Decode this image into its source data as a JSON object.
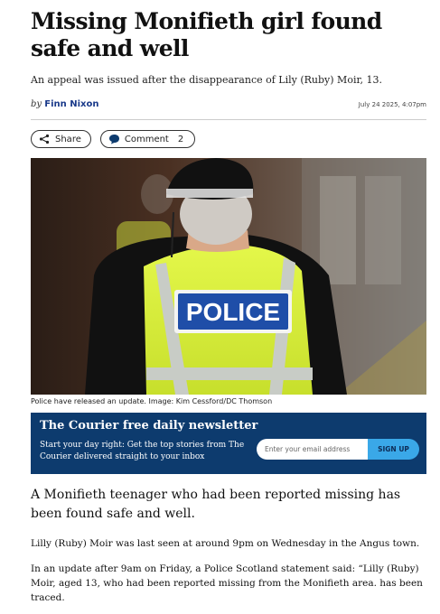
{
  "article": {
    "headline": "Missing Monifieth girl found safe and well",
    "standfirst": "An appeal was issued after the disappearance of Lily (Ruby) Moir, 13.",
    "byline_prefix": "by",
    "author": "Finn Nixon",
    "timestamp": "July 24 2025, 4:07pm"
  },
  "actions": {
    "share_label": "Share",
    "comment_label": "Comment",
    "comment_count": "2"
  },
  "image": {
    "badge_text": "POLICE",
    "caption": "Police have released an update. Image: Kim Cessford/DC Thomson"
  },
  "newsletter": {
    "title": "The Courier free daily newsletter",
    "text": "Start your day right: Get the top stories from The Courier delivered straight to your inbox",
    "email_placeholder": "Enter your email address",
    "button_label": "SIGN UP"
  },
  "body": {
    "lead": "A Monifieth teenager who had been reported missing has been found safe and well.",
    "p1": "Lilly (Ruby) Moir was last seen at around 9pm on Wednesday in the Angus town.",
    "p2": "In an update after 9am on Friday, a Police Scotland statement said: “Lilly (Ruby) Moir, aged 13, who had been reported missing from the Monifieth area. has been traced."
  },
  "colors": {
    "newsletter_bg": "#0d3b6e",
    "signup_button": "#3aa8e8",
    "author_link": "#1a3a8a",
    "hi_vis_yellow": "#d9f23a",
    "police_badge_blue": "#1f4ea8"
  },
  "icons": {
    "share": "share-icon",
    "comment": "comment-bubble-icon"
  }
}
